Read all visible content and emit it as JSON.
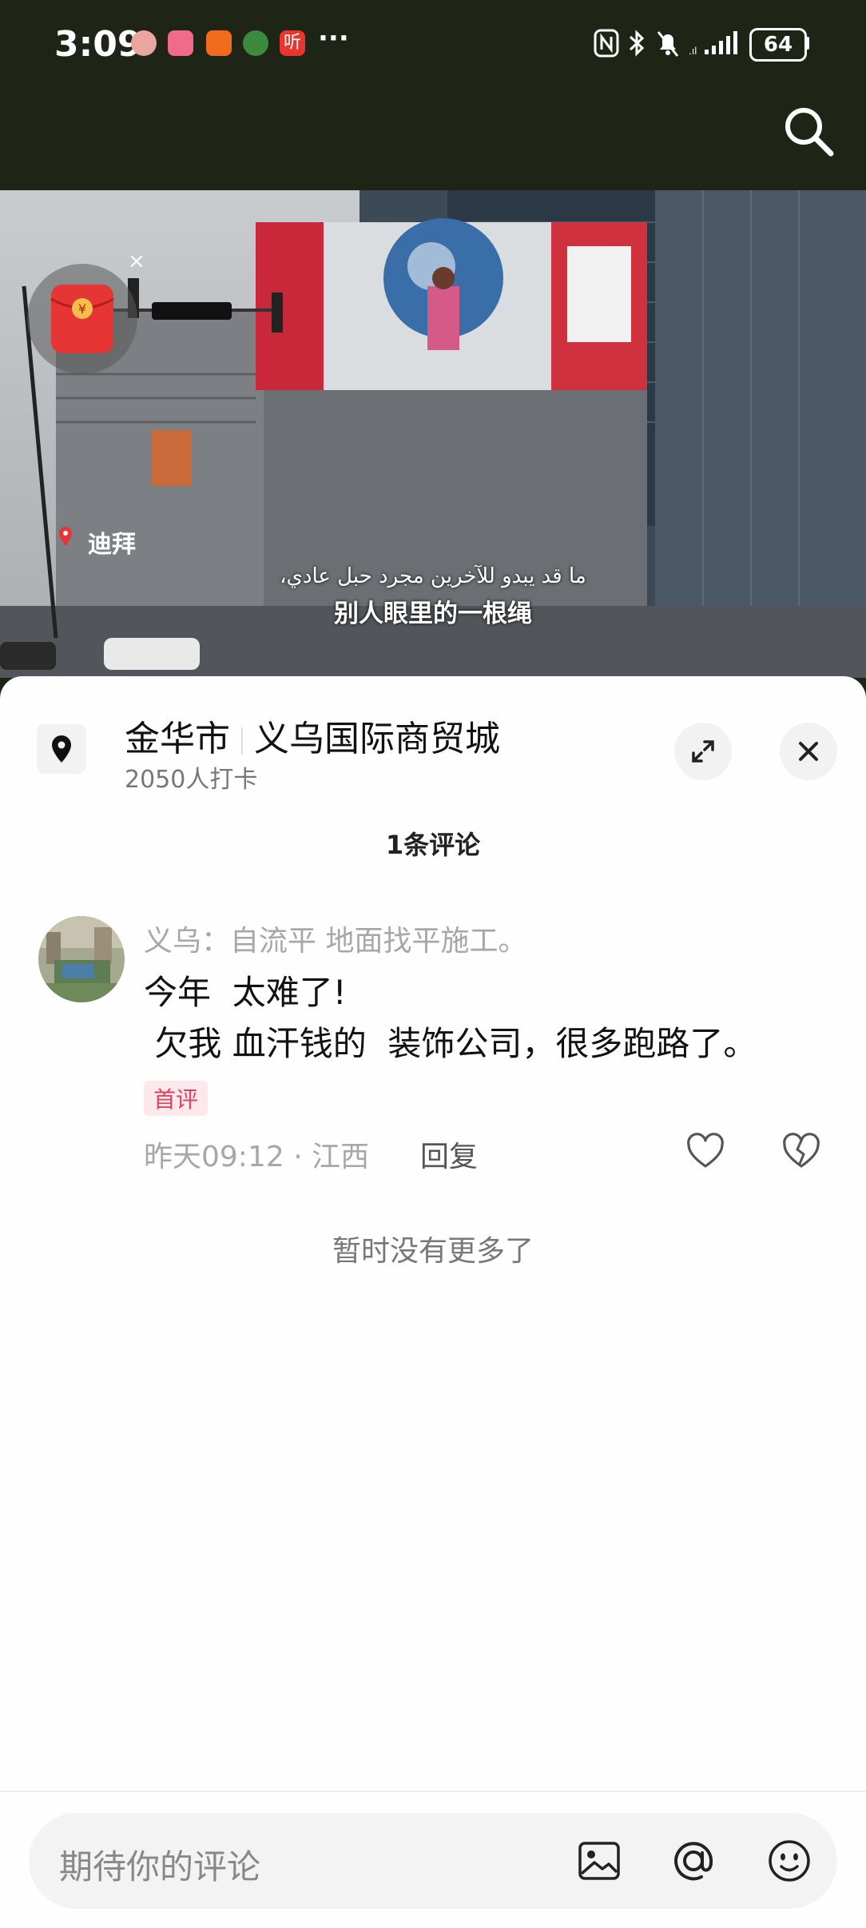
{
  "status_bar": {
    "time": "3:09",
    "more_glyph": "···",
    "battery": "64",
    "app_icons": [
      "avatar-app-icon",
      "bilibili-icon",
      "taobao-icon",
      "game-icon",
      "listen-app-icon"
    ],
    "app_icon_colors": [
      "#e9a6a0",
      "#f06a8a",
      "#f26b1d",
      "#3b8a3e",
      "#e8352e"
    ],
    "listen_glyph": "听"
  },
  "video": {
    "location_tag": "迪拜",
    "subtitle_arabic": "ما قد يبدو للآخرين مجرد حبل عادي،",
    "subtitle_chinese": "别人眼里的一根绳",
    "redpacket_close": "×"
  },
  "location": {
    "city": "金华市",
    "place": "义乌国际商贸城",
    "checkins": "2050人打卡"
  },
  "comments": {
    "count_label": "1条评论",
    "items": [
      {
        "author": "义乌：自流平  地面找平施工。",
        "text": "今年  太难了!\n 欠我 血汗钱的  装饰公司，很多跑路了。",
        "badge": "首评",
        "time_region": "昨天09:12 · 江西",
        "reply_label": "回复"
      }
    ],
    "end_label": "暂时没有更多了"
  },
  "input": {
    "placeholder": "期待你的评论"
  },
  "colors": {
    "header_bg": "#1e2517",
    "accent_red": "#e2425f",
    "sheet_bg": "#fefefe"
  }
}
